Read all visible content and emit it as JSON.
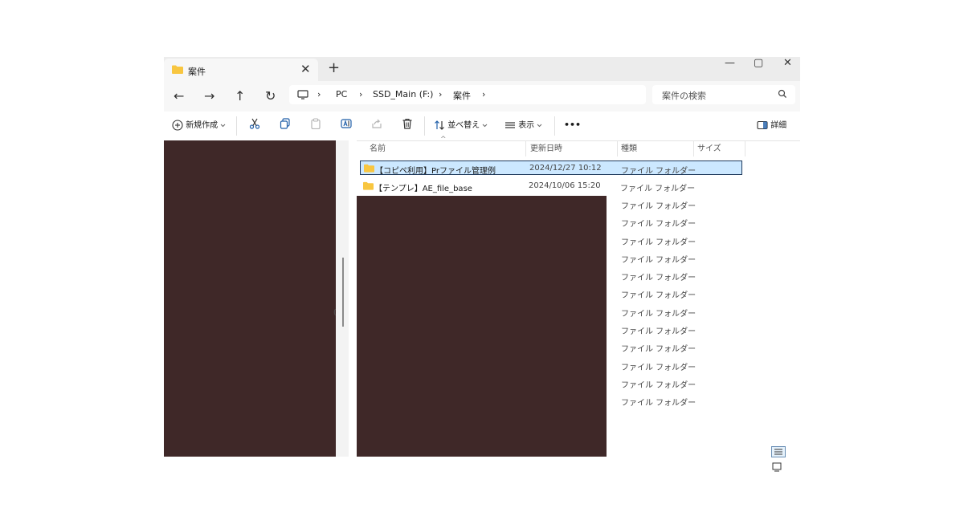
{
  "window": {
    "tab_title": "案件",
    "tab_close": "✕",
    "tab_new": "+",
    "controls": {
      "minimize": "—",
      "maximize": "▢",
      "close": "✕"
    }
  },
  "nav": {
    "back": "←",
    "forward": "→",
    "up": "↑",
    "refresh": "↻",
    "breadcrumb": [
      "PC",
      "SSD_Main (F:)",
      "案件"
    ],
    "separator": "›",
    "search_placeholder": "案件の検索"
  },
  "toolbar": {
    "new_label": "新規作成",
    "sort_label": "並べ替え",
    "view_label": "表示",
    "more_label": "•••",
    "details_label": "詳細"
  },
  "columns": {
    "name": "名前",
    "date": "更新日時",
    "type": "種類",
    "size": "サイズ"
  },
  "rows": [
    {
      "name": "【コピペ利用】Prファイル管理例",
      "date": "2024/12/27 10:12",
      "type": "ファイル フォルダー",
      "selected": true
    },
    {
      "name": "【テンプレ】AE_file_base",
      "date": "2024/10/06 15:20",
      "type": "ファイル フォルダー",
      "selected": false
    }
  ],
  "hidden_rows_type": "ファイル フォルダー",
  "left_glyph": "(",
  "colors": {
    "accent": "#cce8ff",
    "folder": "#f8c640",
    "redaction": "#3f2828"
  }
}
